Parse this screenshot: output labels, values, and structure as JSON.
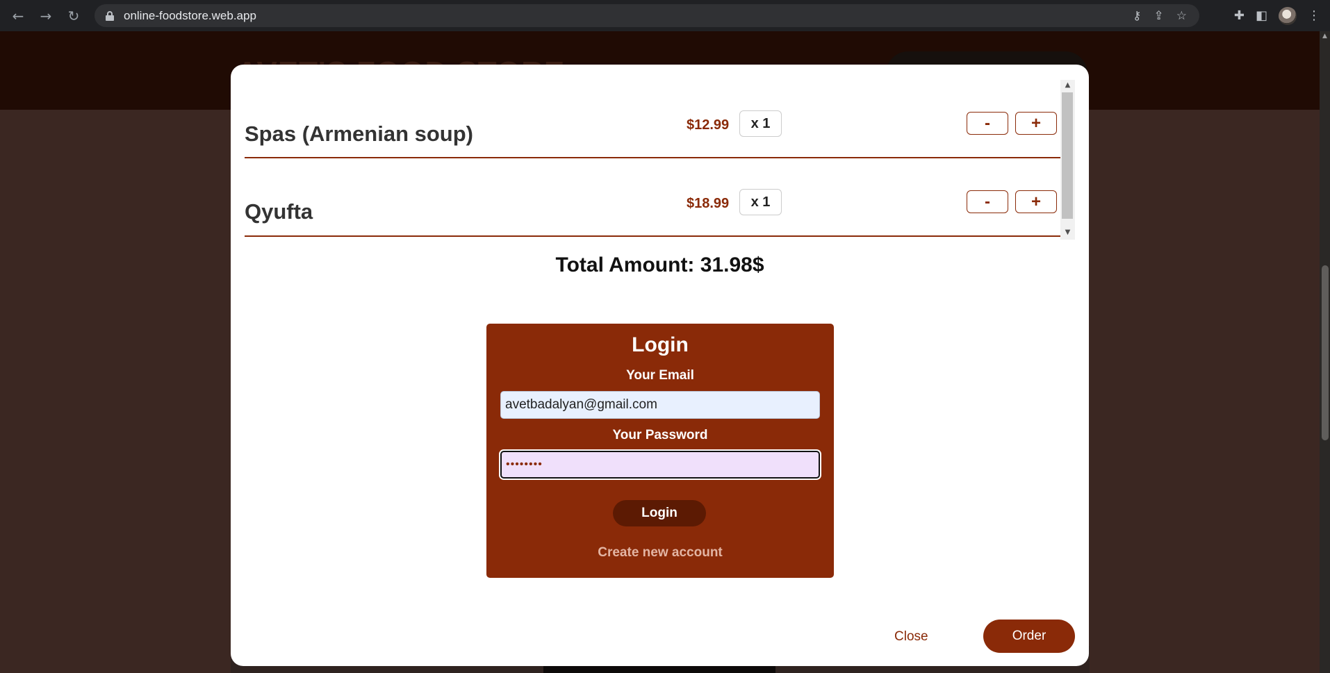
{
  "browser": {
    "url": "online-foodstore.web.app",
    "back_icon": "←",
    "forward_icon": "→",
    "reload_icon": "↻",
    "key_icon": "⚷",
    "share_icon": "⇪",
    "star_icon": "☆",
    "extensions_icon": "✚",
    "sidepanel_icon": "◧",
    "menu_icon": "⋮"
  },
  "page": {
    "title": "AVET'S FOOD STORE"
  },
  "cart": {
    "items": [
      {
        "name": "Spas (Armenian soup)",
        "price": "$12.99",
        "quantity": "x 1",
        "minus_label": "-",
        "plus_label": "+"
      },
      {
        "name": "Qyufta",
        "price": "$18.99",
        "quantity": "x 1",
        "minus_label": "-",
        "plus_label": "+"
      }
    ],
    "total": "Total Amount: 31.98$"
  },
  "login": {
    "title": "Login",
    "email_label": "Your Email",
    "email_value": "avetbadalyan@gmail.com",
    "password_label": "Your Password",
    "password_value": "••••••••",
    "submit_label": "Login",
    "create_account_label": "Create new account"
  },
  "actions": {
    "close_label": "Close",
    "order_label": "Order"
  },
  "colors": {
    "accent": "#8a2a08",
    "login_bg": "#8a2a08",
    "login_button": "#5c1a03",
    "header_bg": "#200b04"
  }
}
